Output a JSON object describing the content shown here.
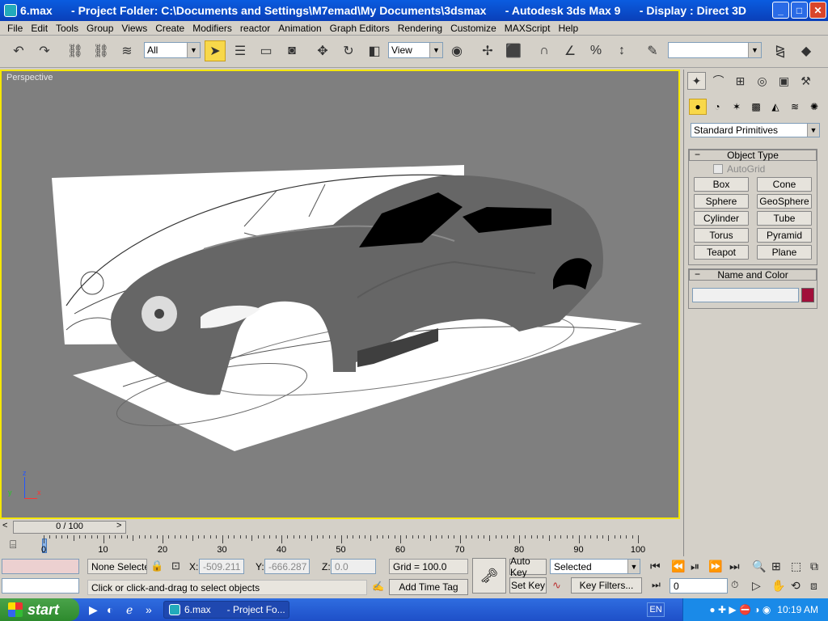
{
  "window": {
    "title": "6.max      - Project Folder: C:\\Documents and Settings\\M7emad\\My Documents\\3dsmax      - Autodesk 3ds Max 9      - Display : Direct 3D",
    "minimize": "_",
    "maximize": "□",
    "close": "✕"
  },
  "menu": [
    "File",
    "Edit",
    "Tools",
    "Group",
    "Views",
    "Create",
    "Modifiers",
    "reactor",
    "Animation",
    "Graph Editors",
    "Rendering",
    "Customize",
    "MAXScript",
    "Help"
  ],
  "toolbar": {
    "selection_filter": "All",
    "reference_coord": "View",
    "named_selection": ""
  },
  "viewport": {
    "label": "Perspective",
    "axes": {
      "z": "z",
      "y": "y",
      "x": "x"
    }
  },
  "command_panel": {
    "category": "Standard Primitives",
    "object_type_title": "Object Type",
    "autogrid_label": "AutoGrid",
    "primitives": [
      "Box",
      "Cone",
      "Sphere",
      "GeoSphere",
      "Cylinder",
      "Tube",
      "Torus",
      "Pyramid",
      "Teapot",
      "Plane"
    ],
    "name_color_title": "Name and Color",
    "object_name": "",
    "object_color": "#a10f3a",
    "minus": "−"
  },
  "timeline": {
    "slider_label": "0 / 100",
    "prev": "<",
    "next": ">",
    "ticks": [
      "0",
      "10",
      "20",
      "30",
      "40",
      "50",
      "60",
      "70",
      "80",
      "90",
      "100"
    ]
  },
  "status": {
    "selection": "None Selecte",
    "x_label": "X:",
    "x_value": "-509.211",
    "y_label": "Y:",
    "y_value": "-666.287",
    "z_label": "Z:",
    "z_value": "0.0",
    "grid": "Grid = 100.0",
    "prompt": "Click or click-and-drag to select objects",
    "add_time_tag": "Add Time Tag",
    "auto_key": "Auto Key",
    "set_key": "Set Key",
    "key_mode": "Selected",
    "key_filters": "Key Filters...",
    "frame": "0"
  },
  "taskbar": {
    "start": "start",
    "task_label": "6.max      - Project Fo...",
    "lang": "EN",
    "clock": "10:19 AM",
    "more": "»"
  }
}
